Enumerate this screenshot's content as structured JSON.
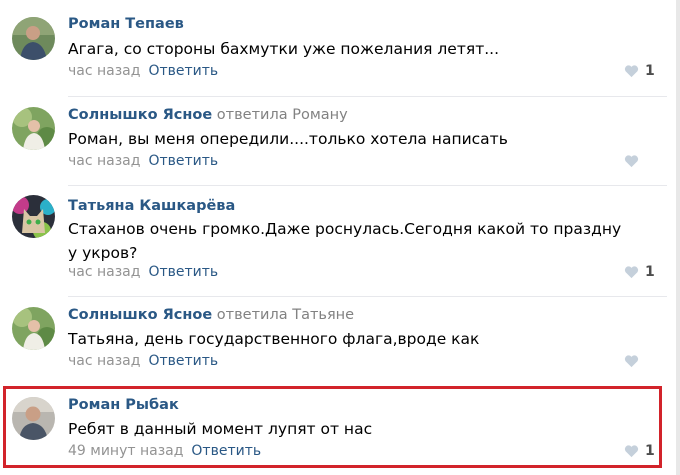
{
  "comments": [
    {
      "author": "Роман Тепаев",
      "reply_to_verb": "",
      "reply_to_name": "",
      "text": "Агага, со стороны бахмутки уже пожелания летят...",
      "time": "час назад",
      "reply_label": "Ответить",
      "likes": "1",
      "avatar_icon": "avatar-photo-man-green-bg"
    },
    {
      "author": "Солнышко Ясное",
      "reply_to_verb": "ответила",
      "reply_to_name": "Роману",
      "text": "Роман, вы меня опередили....только хотела написать",
      "time": "час назад",
      "reply_label": "Ответить",
      "likes": "",
      "avatar_icon": "avatar-photo-woman-greenery"
    },
    {
      "author": "Татьяна Кашкарёва",
      "reply_to_verb": "",
      "reply_to_name": "",
      "text": "Стаханов очень громко.Даже роснулась.Сегодня какой то праздну у укров?",
      "time": "час назад",
      "reply_label": "Ответить",
      "likes": "1",
      "avatar_icon": "avatar-photo-cat-colorful"
    },
    {
      "author": "Солнышко Ясное",
      "reply_to_verb": "ответила",
      "reply_to_name": "Татьяне",
      "text": "Татьяна, день государственного флага,вроде как",
      "time": "час назад",
      "reply_label": "Ответить",
      "likes": "",
      "avatar_icon": "avatar-photo-woman-greenery"
    },
    {
      "author": "Роман Рыбак",
      "reply_to_verb": "",
      "reply_to_name": "",
      "text": "Ребят в данный момент лупят от нас",
      "time": "49 минут назад",
      "reply_label": "Ответить",
      "likes": "1",
      "avatar_icon": "avatar-photo-man-grey-bg"
    }
  ],
  "colors": {
    "link": "#2a5885",
    "meta": "#939393",
    "highlight_border": "#d2232a",
    "heart": "#c5d0db"
  },
  "icons": {
    "like": "heart-icon"
  }
}
